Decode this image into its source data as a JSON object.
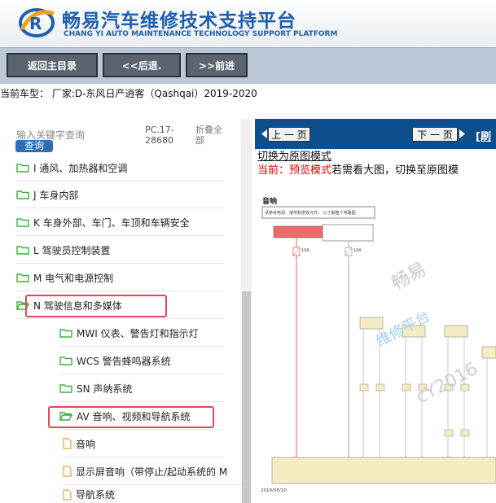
{
  "header": {
    "title_cn": "畅易汽车维修技术支持平台",
    "title_en": "CHANG YI AUTO MAINTENANCE TECHNOLOGY SUPPORT PLATFORM"
  },
  "nav": {
    "home": "返回主目录",
    "back": "<<后退.",
    "forward": ">>前进"
  },
  "vehicle": {
    "line": "当前车型： 厂家:D-东风日产逍客（Qashqai）2019-2020"
  },
  "sidebar": {
    "search_placeholder": "输入关键字查询",
    "search_button": "查询",
    "pc_code": "PC.17-28680",
    "collapse_all": "折叠全部",
    "items": [
      {
        "label": "I 通风、加热器和空调"
      },
      {
        "label": "J 车身内部"
      },
      {
        "label": "K 车身外部、车门、车顶和车辆安全"
      },
      {
        "label": "L 驾驶员控制装置"
      },
      {
        "label": "M 电气和电源控制"
      },
      {
        "label": "N 驾驶信息和多媒体"
      },
      {
        "label": "MWI 仪表、警告灯和指示灯"
      },
      {
        "label": "WCS 警告蜂鸣器系统"
      },
      {
        "label": "SN 声纳系统"
      },
      {
        "label": "AV 音响、视频和导航系统"
      },
      {
        "label": "音响"
      },
      {
        "label": "显示屏音响（带停止/起动系统的 M"
      },
      {
        "label": "导航系统"
      }
    ]
  },
  "viewer": {
    "prev_page": "上 一 页",
    "next_page": "下 一 页",
    "refresh": "[刷",
    "switch_link": "切换为原图模式",
    "current_label": "当前：",
    "mode": "预览模式",
    "hint": "若需看大图，切换至原图模",
    "diagram_title": "音响",
    "diagram_note": "请参考电源、接地和搭铁元件，\n以了解整个电路图",
    "diagram_date": "2018/08/10",
    "fuse_a": "10A",
    "fuse_b": "10A",
    "watermark_line1": "畅易",
    "watermark_line2": "维修平台",
    "watermark_line3": "cY2016"
  },
  "colors": {
    "brand_blue": "#1d5fae",
    "nav_bg": "#b9c7d6",
    "viewer_bar": "#0d4e8c",
    "highlight": "#e0485b",
    "mode_red": "#e00000",
    "folder_green": "#3bb23b",
    "doc_orange": "#e8a23a"
  }
}
